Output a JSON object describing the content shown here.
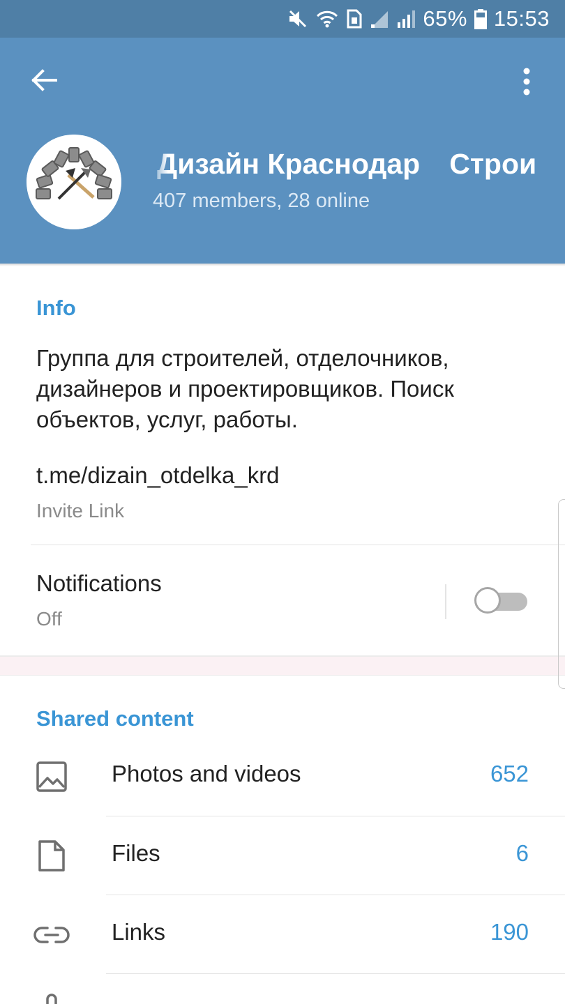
{
  "status_bar": {
    "battery": "65%",
    "time": "15:53"
  },
  "header": {
    "title_part1": "Дизайн Краснодар",
    "title_part2": "Строи",
    "subtitle": "407 members, 28 online"
  },
  "info": {
    "section_title": "Info",
    "description": "Группа для строителей, отделочников, дизайнеров и проектировщиков. Поиск объектов, услуг, работы.",
    "invite_link": "t.me/dizain_otdelka_krd",
    "invite_caption": "Invite Link"
  },
  "notifications": {
    "label": "Notifications",
    "value": "Off",
    "enabled": false
  },
  "shared": {
    "section_title": "Shared content",
    "items": [
      {
        "label": "Photos and videos",
        "count": "652",
        "icon": "image-icon"
      },
      {
        "label": "Files",
        "count": "6",
        "icon": "file-icon"
      },
      {
        "label": "Links",
        "count": "190",
        "icon": "link-icon"
      }
    ]
  },
  "colors": {
    "status_bar": "#4f7fa6",
    "header": "#5b91c0",
    "accent": "#3a95d5"
  }
}
